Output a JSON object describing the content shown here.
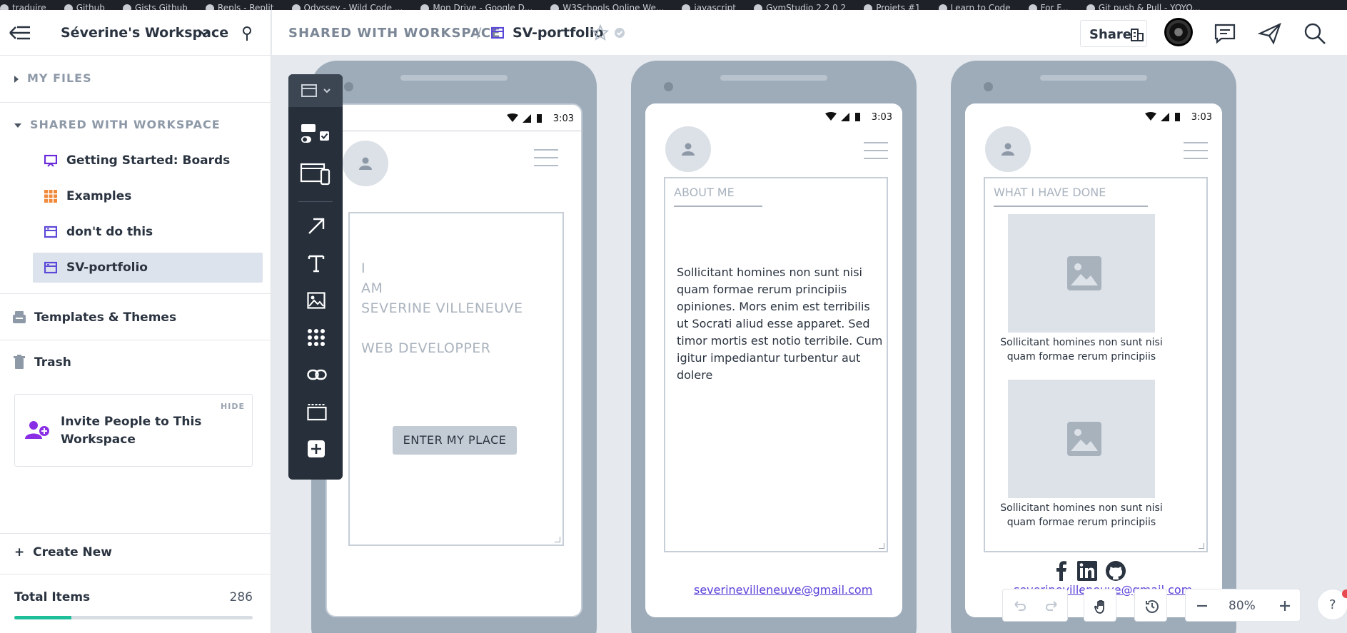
{
  "bookmarks": [
    "traduire",
    "Github",
    "Gists Github",
    "Repls - Replit",
    "Odyssey - Wild Code ...",
    "Mon Drive - Google D...",
    "W3Schools Online We...",
    "javascript",
    "GymStudio 2 2 0 2",
    "Projets #1",
    "Learn to Code",
    "For F...",
    "Git push & Pull - YOYO..."
  ],
  "sidebar": {
    "workspace_name": "Séverine's Workspace",
    "my_files": "MY FILES",
    "shared_section": "SHARED WITH WORKSPACE",
    "items": [
      {
        "label": "Getting Started: Boards",
        "icon": "board-icon"
      },
      {
        "label": "Examples",
        "icon": "grid-icon"
      },
      {
        "label": "don't do this",
        "icon": "wireframe-icon"
      },
      {
        "label": "SV-portfolio",
        "icon": "wireframe-icon",
        "active": true
      }
    ],
    "templates": "Templates & Themes",
    "trash": "Trash",
    "invite": {
      "text": "Invite People to This Workspace",
      "hide": "HIDE"
    },
    "create_new": "Create New",
    "total_items_label": "Total Items",
    "total_items_count": "286",
    "storage_fraction": 0.24
  },
  "topbar": {
    "breadcrumb": "SHARED WITH WORKSPACE",
    "separator": "/",
    "doc_title": "SV-portfolio",
    "share_label": "Share"
  },
  "screens": {
    "status_time": "3:03",
    "intro": {
      "lines": [
        "I",
        "AM",
        "SEVERINE VILLENEUVE",
        "WEB DEVELOPPER"
      ],
      "button": "ENTER MY PLACE"
    },
    "about": {
      "title": "ABOUT ME",
      "text": "Sollicitant homines non sunt nisi quam formae rerum principiis opiniones. Mors enim est terribilis ut Socrati aliud esse apparet. Sed timor mortis est notio terribile. Cum igitur impediantur turbentur aut dolere",
      "email": "severinevilleneuve@gmail.com"
    },
    "works": {
      "title": "WHAT I HAVE DONE",
      "caption1": "Sollicitant homines non sunt nisi quam formae rerum principiis",
      "caption2": "Sollicitant homines non sunt nisi quam formae rerum principiis",
      "email": "severinevilleneuve@gmail.com"
    }
  },
  "zoom": "80%",
  "help": "?",
  "colors": {
    "accent": "#5a3fd8",
    "progress": "#1fbf9a",
    "toolbar": "#262f3a",
    "phone": "#9eacba"
  }
}
